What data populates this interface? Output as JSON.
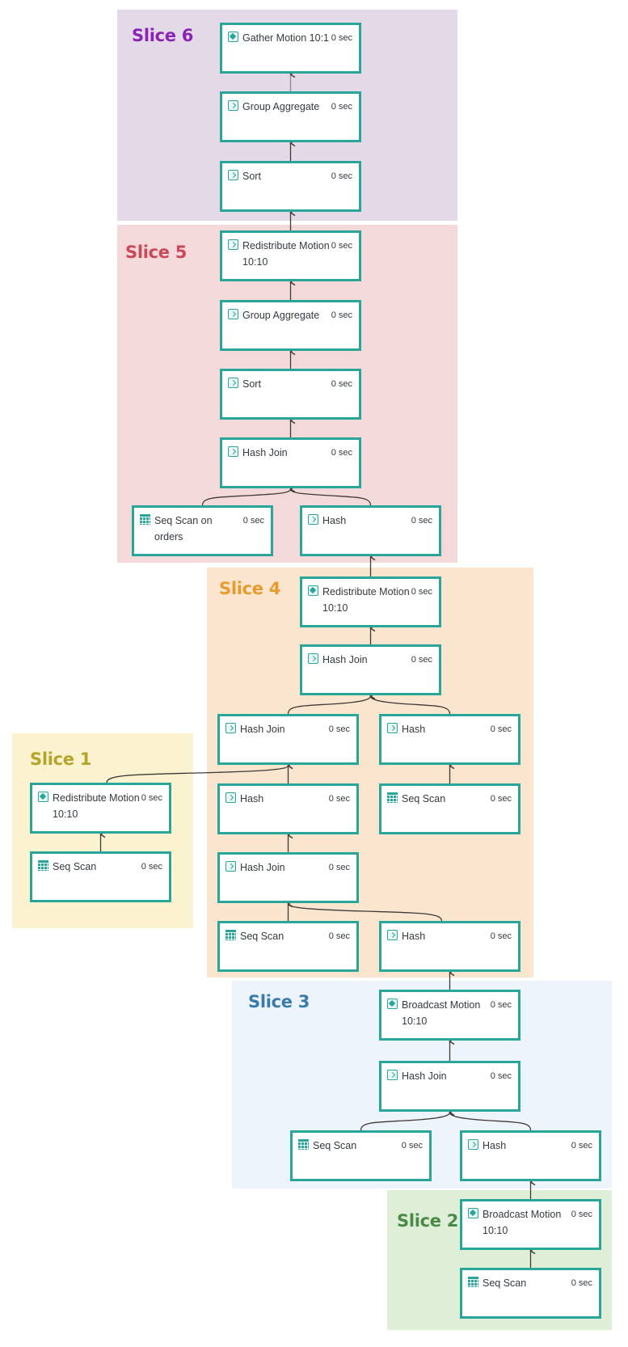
{
  "slices": [
    {
      "id": "slice-6",
      "label": "Slice 6",
      "bg": "#e4d9e6",
      "color": "#8b24b5"
    },
    {
      "id": "slice-5",
      "label": "Slice 5",
      "bg": "#f3d9d9",
      "color": "#c9485a"
    },
    {
      "id": "slice-4",
      "label": "Slice 4",
      "bg": "#fae6cf",
      "color": "#e89a2c"
    },
    {
      "id": "slice-1",
      "label": "Slice 1",
      "bg": "#fbf2cf",
      "color": "#b5a42b"
    },
    {
      "id": "slice-3",
      "label": "Slice 3",
      "bg": "#eef4fb",
      "color": "#3a7bab"
    },
    {
      "id": "slice-2",
      "label": "Slice 2",
      "bg": "#dfeed6",
      "color": "#4a8a46"
    }
  ],
  "nodes": [
    {
      "id": "s6-gather",
      "title": "Gather Motion 10:1",
      "time": "0 sec",
      "icon": "motion-icon"
    },
    {
      "id": "s6-groupagg",
      "title": "Group Aggregate",
      "time": "0 sec",
      "icon": "operator-icon"
    },
    {
      "id": "s6-sort",
      "title": "Sort",
      "time": "0 sec",
      "icon": "operator-icon"
    },
    {
      "id": "s5-redistribute",
      "title": "Redistribute Motion 10:10",
      "time": "0 sec",
      "icon": "operator-icon"
    },
    {
      "id": "s5-groupagg",
      "title": "Group Aggregate",
      "time": "0 sec",
      "icon": "operator-icon"
    },
    {
      "id": "s5-sort",
      "title": "Sort",
      "time": "0 sec",
      "icon": "operator-icon"
    },
    {
      "id": "s5-hashjoin",
      "title": "Hash Join",
      "time": "0 sec",
      "icon": "operator-icon"
    },
    {
      "id": "s5-seqscan-orders",
      "title": "Seq Scan on orders",
      "time": "0 sec",
      "icon": "table-icon"
    },
    {
      "id": "s5-hash",
      "title": "Hash",
      "time": "0 sec",
      "icon": "operator-icon"
    },
    {
      "id": "s4-redistribute",
      "title": "Redistribute Motion 10:10",
      "time": "0 sec",
      "icon": "motion-icon"
    },
    {
      "id": "s4-hashjoin-top",
      "title": "Hash Join",
      "time": "0 sec",
      "icon": "operator-icon"
    },
    {
      "id": "s4-hashjoin-mid",
      "title": "Hash Join",
      "time": "0 sec",
      "icon": "operator-icon"
    },
    {
      "id": "s4-hash-right",
      "title": "Hash",
      "time": "0 sec",
      "icon": "operator-icon"
    },
    {
      "id": "s4-hash-left",
      "title": "Hash",
      "time": "0 sec",
      "icon": "operator-icon"
    },
    {
      "id": "s4-seqscan-right",
      "title": "Seq Scan",
      "time": "0 sec",
      "icon": "table-icon"
    },
    {
      "id": "s4-hashjoin-low",
      "title": "Hash Join",
      "time": "0 sec",
      "icon": "operator-icon"
    },
    {
      "id": "s4-seqscan-bottom",
      "title": "Seq Scan",
      "time": "0 sec",
      "icon": "table-icon"
    },
    {
      "id": "s4-hash-bottom",
      "title": "Hash",
      "time": "0 sec",
      "icon": "operator-icon"
    },
    {
      "id": "s1-redistribute",
      "title": "Redistribute Motion 10:10",
      "time": "0 sec",
      "icon": "motion-icon"
    },
    {
      "id": "s1-seqscan",
      "title": "Seq Scan",
      "time": "0 sec",
      "icon": "table-icon"
    },
    {
      "id": "s3-broadcast",
      "title": "Broadcast Motion 10:10",
      "time": "0 sec",
      "icon": "motion-icon"
    },
    {
      "id": "s3-hashjoin",
      "title": "Hash Join",
      "time": "0 sec",
      "icon": "operator-icon"
    },
    {
      "id": "s3-seqscan",
      "title": "Seq Scan",
      "time": "0 sec",
      "icon": "table-icon"
    },
    {
      "id": "s3-hash",
      "title": "Hash",
      "time": "0 sec",
      "icon": "operator-icon"
    },
    {
      "id": "s2-broadcast",
      "title": "Broadcast Motion 10:10",
      "time": "0 sec",
      "icon": "motion-icon"
    },
    {
      "id": "s2-seqscan",
      "title": "Seq Scan",
      "time": "0 sec",
      "icon": "table-icon"
    }
  ],
  "edges": [
    [
      "s6-groupagg",
      "s6-gather"
    ],
    [
      "s6-sort",
      "s6-groupagg"
    ],
    [
      "s5-redistribute",
      "s6-sort"
    ],
    [
      "s5-groupagg",
      "s5-redistribute"
    ],
    [
      "s5-sort",
      "s5-groupagg"
    ],
    [
      "s5-hashjoin",
      "s5-sort"
    ],
    [
      "s5-seqscan-orders",
      "s5-hashjoin"
    ],
    [
      "s5-hash",
      "s5-hashjoin"
    ],
    [
      "s4-redistribute",
      "s5-hash"
    ],
    [
      "s4-hashjoin-top",
      "s4-redistribute"
    ],
    [
      "s4-hashjoin-mid",
      "s4-hashjoin-top"
    ],
    [
      "s4-hash-right",
      "s4-hashjoin-top"
    ],
    [
      "s4-seqscan-right",
      "s4-hash-right"
    ],
    [
      "s1-redistribute",
      "s4-hashjoin-mid"
    ],
    [
      "s4-hash-left",
      "s4-hashjoin-mid"
    ],
    [
      "s4-hashjoin-low",
      "s4-hash-left"
    ],
    [
      "s4-seqscan-bottom",
      "s4-hashjoin-low"
    ],
    [
      "s4-hash-bottom",
      "s4-hashjoin-low"
    ],
    [
      "s1-seqscan",
      "s1-redistribute"
    ],
    [
      "s3-broadcast",
      "s4-hash-bottom"
    ],
    [
      "s3-hashjoin",
      "s3-broadcast"
    ],
    [
      "s3-seqscan",
      "s3-hashjoin"
    ],
    [
      "s3-hash",
      "s3-hashjoin"
    ],
    [
      "s2-broadcast",
      "s3-hash"
    ],
    [
      "s2-seqscan",
      "s2-broadcast"
    ]
  ],
  "colors": {
    "node_border": "#2aa59a",
    "edge": "#3f3a36"
  }
}
